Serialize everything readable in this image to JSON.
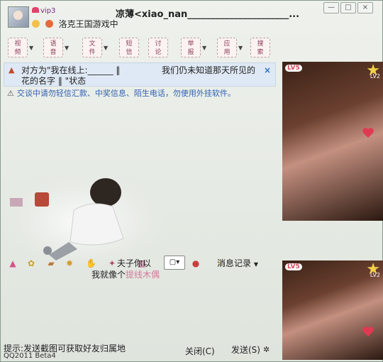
{
  "window": {
    "vip_label": "vip3",
    "contact_title": "凉薄<xiao_nan______________________...",
    "status_text": "洛克王国游戏中",
    "controls": [
      "—",
      "□",
      "×"
    ]
  },
  "toolbar": {
    "items": [
      {
        "label": "视\n频"
      },
      {
        "label": "语\n音"
      },
      {
        "label": "文\n件"
      },
      {
        "label": "短\n信"
      },
      {
        "label": "讨\n论"
      },
      {
        "label": "举\n报"
      },
      {
        "label": "应\n用"
      },
      {
        "label": "搜\n索"
      }
    ]
  },
  "notice": {
    "line1": "对方为\"我在线上:______ ‖",
    "line1_right": "我们仍未知道那天所见的",
    "line2": "花的名字 ‖ \"状态",
    "close": "×"
  },
  "security_tip": "交谈中请勿轻信汇款、中奖信息、陌生电话，勿使用外挂软件。",
  "input_area": {
    "top_text": "夫子你以",
    "text_main": "我就像个",
    "text_pink": "提线木偶"
  },
  "bottom_toolbar": {
    "record_label": "消息记录"
  },
  "footer": {
    "tip": "提示:发送截图可获取好友归属地",
    "version": "QQ2011 Beta4",
    "close_button": "关闭(C)",
    "send_button": "发送(S)"
  },
  "photos": {
    "level_badge": "LV5",
    "level2": "LV2"
  },
  "colors": {
    "accent_blue": "#2f5fb2",
    "warn_red": "#c24a2a",
    "pink": "#d47b9c"
  }
}
